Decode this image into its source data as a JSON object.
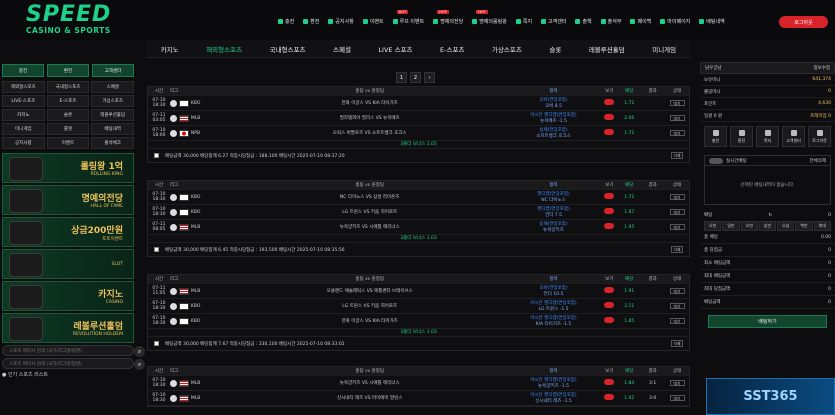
{
  "brand": {
    "logo": "SPEED",
    "tagline": "CASINO & SPORTS"
  },
  "topmenu": [
    {
      "label": "충전",
      "hot": ""
    },
    {
      "label": "환전",
      "hot": ""
    },
    {
      "label": "공지사항",
      "hot": ""
    },
    {
      "label": "이벤트",
      "hot": ""
    },
    {
      "label": "루프 이벤트",
      "hot": "HOT"
    },
    {
      "label": "명예의전당",
      "hot": "HOT"
    },
    {
      "label": "명예의롤링왕",
      "hot": "HOT"
    },
    {
      "label": "쪽지",
      "hot": ""
    },
    {
      "label": "고객센터",
      "hot": ""
    },
    {
      "label": "출첵",
      "hot": ""
    },
    {
      "label": "출석부",
      "hot": ""
    },
    {
      "label": "페이백",
      "hot": ""
    },
    {
      "label": "마이페이지",
      "hot": ""
    },
    {
      "label": "베팅내역",
      "hot": ""
    }
  ],
  "logout_label": "로그아웃",
  "nav": [
    "카지노",
    "해외형스포츠",
    "국내형스포츠",
    "스페셜",
    "LIVE 스포츠",
    "E-스포츠",
    "가상스포츠",
    "슬롯",
    "레볼루션홀덤",
    "미니게임"
  ],
  "left": {
    "buttons": [
      "충전",
      "환전",
      "고객센터"
    ],
    "grid": [
      "해외형스포츠",
      "국내형스포츠",
      "스페셜",
      "LIVE-스포츠",
      "E-스포츠",
      "가상스포츠",
      "카지노",
      "슬롯",
      "레볼루션홀덤",
      "미니게임",
      "룰렛",
      "배팅내역",
      "공지사항",
      "이벤트",
      "출석체크"
    ],
    "banners": [
      {
        "title": "롤링왕 1억",
        "sub": "ROLLING KING"
      },
      {
        "title": "명예의전당",
        "sub": "HALL OF FAME"
      },
      {
        "title": "상금200만원",
        "sub": "토토이벤트"
      },
      {
        "title": "",
        "sub": "SLOT"
      },
      {
        "title": "카지노",
        "sub": "CASINO"
      },
      {
        "title": "레볼루션홀덤",
        "sub": "REVOLUTION HOLDEM"
      }
    ],
    "search1": "스포츠 여러사 검색 (국가/리그명/팀명)",
    "search2": "스포츠 여러사 검색 (국가/리그명/팀명)",
    "footer": "인기 스포츠 리스트"
  },
  "pager": [
    "1",
    "2",
    "›"
  ],
  "table_header": {
    "time": "시간",
    "league": "리그",
    "match": "홈팀 vs 원정팀",
    "bet": "항목",
    "view": "보기",
    "odds": "배당",
    "result": "결과",
    "status": "상태"
  },
  "blocks": [
    {
      "rows": [
        {
          "date": "07-10",
          "time": "18:30",
          "flag": "kr",
          "league": "KBO",
          "match": "한화 이글스 VS KIA 타이거즈",
          "bet1": "오버(연장포함)",
          "bet2": "오버 8.5",
          "odds": "1.72",
          "result": "",
          "status": "대기"
        },
        {
          "date": "07-11",
          "time": "03:05",
          "flag": "us",
          "league": "MLB",
          "match": "필라델피아 필리스 VS 뉴욕메츠",
          "bet1": "아시안 핸디캡(연장포함)",
          "bet2": "뉴욕메츠 -1.5",
          "odds": "2.06",
          "result": "",
          "status": "대기"
        },
        {
          "date": "07-10",
          "time": "18:00",
          "flag": "jp",
          "league": "NPB",
          "match": "오릭스 버팔로즈 VS 소프트뱅크 호크스",
          "bet1": "승패(연장포함)",
          "bet2": "소프트뱅크 호크스",
          "odds": "1.72",
          "result": "",
          "status": "대기"
        }
      ],
      "bonus": "3폴더 보너스",
      "bonus_v": "1.03",
      "summary": "배팅금액 30,000  배당합계 6.27  적중시당첨금 : 188,100  배팅시간 2025-07-10 08:37:20"
    },
    {
      "rows": [
        {
          "date": "07-10",
          "time": "18:30",
          "flag": "kr",
          "league": "KBO",
          "match": "NC 다이노스 VS 삼성 라이온즈",
          "bet1": "핸디캡(연장포함)",
          "bet2": "NC 다이노스",
          "odds": "1.72",
          "result": "",
          "status": "대기"
        },
        {
          "date": "07-10",
          "time": "18:30",
          "flag": "kr",
          "league": "KBO",
          "match": "LG 트윈스 VS 키움 히어로즈",
          "bet1": "핸디캡(연장포함)",
          "bet2": "언더 7.5",
          "odds": "1.87",
          "result": "",
          "status": "대기"
        },
        {
          "date": "07-11",
          "time": "08:05",
          "flag": "us",
          "league": "MLB",
          "match": "뉴욕양키즈 VS 시애틀 매리너스",
          "bet1": "승패(연장포함)",
          "bet2": "뉴욕양키즈",
          "odds": "1.95",
          "result": "",
          "status": "대기"
        }
      ],
      "bonus": "3폴더 보너스",
      "bonus_v": "1.03",
      "summary": "배팅금액 30,000  배당합계 6.45  적중시당첨금 : 193,500  배팅시간 2025-07-10 08:35:56"
    },
    {
      "rows": [
        {
          "date": "07-11",
          "time": "11:05",
          "flag": "us",
          "league": "MLB",
          "match": "오클랜드 애슬레틱스 VS 애틀랜타 브레이브스",
          "bet1": "오버(연장포함)",
          "bet2": "언더 10.5",
          "odds": "1.91",
          "result": "",
          "status": "대기"
        },
        {
          "date": "07-10",
          "time": "18:30",
          "flag": "kr",
          "league": "KBO",
          "match": "LG 트윈스 VS 키움 히어로즈",
          "bet1": "아시안 핸디캡(연장포함)",
          "bet2": "LG 트윈스 -1.5",
          "odds": "2.11",
          "result": "",
          "status": "대기"
        },
        {
          "date": "07-10",
          "time": "18:30",
          "flag": "kr",
          "league": "KBO",
          "match": "한화 이글스 VS KIA 타이거즈",
          "bet1": "아시안 핸디캡(연장포함)",
          "bet2": "KIA 타이거즈 -1.5",
          "odds": "1.85",
          "result": "",
          "status": "대기"
        }
      ],
      "bonus": "3폴더 보너스",
      "bonus_v": "1.03",
      "summary": "배팅금액 30,000  배당합계 7.67  적중시당첨금 : 230,100  배팅시간 2025-07-10 08:33:02"
    },
    {
      "rows": [
        {
          "date": "07-10",
          "time": "18:30",
          "flag": "us",
          "league": "MLB",
          "match": "뉴욕양키즈 VS 시애틀 매리너스",
          "bet1": "아시안 핸디캡(연장포함)",
          "bet2": "뉴욕양키즈 -1.5",
          "odds": "1.84",
          "result": "3:1",
          "status": "대기"
        },
        {
          "date": "07-10",
          "time": "18:30",
          "flag": "us",
          "league": "MLB",
          "match": "신시내티 레즈 VS 마이애미 말린스",
          "bet1": "아시안 핸디캡(연장포함)",
          "bet2": "신시내티 레즈 -1.5",
          "odds": "1.92",
          "result": "3:0",
          "status": "대기"
        }
      ],
      "bonus": "",
      "bonus_v": "",
      "summary": ""
    }
  ],
  "right": {
    "user": "남우궁남",
    "logout": "정보수정",
    "info": [
      {
        "k": "보유머니",
        "v": "641,374"
      },
      {
        "k": "롤링머니",
        "v": "0"
      },
      {
        "k": "포인트",
        "v": "4,630"
      },
      {
        "k": "일괄 0 원",
        "v": "프레미엄 0"
      }
    ],
    "buttons": [
      "충전",
      "환전",
      "쪽지",
      "고객센터",
      "로그아웃"
    ],
    "cart_title": "실시간배팅",
    "cart_clear": "전체삭제",
    "cart_empty": "선택된 배팅내역이 없습니다.",
    "amount_label": "배팅",
    "amount_value": "0",
    "chips": [
      "오천",
      "일만",
      "오만",
      "십만",
      "오십",
      "백만",
      "최대"
    ],
    "calc": [
      {
        "k": "총 배당",
        "v": "0.00"
      },
      {
        "k": "총 당첨금",
        "v": "0"
      },
      {
        "k": "최소 배팅금액",
        "v": "0"
      },
      {
        "k": "최대 배팅금액",
        "v": "0"
      },
      {
        "k": "최대 당첨금액",
        "v": "0"
      },
      {
        "k": "베팅금액",
        "v": "0"
      }
    ],
    "bet_button": "배팅하기",
    "banner": "SST365"
  }
}
